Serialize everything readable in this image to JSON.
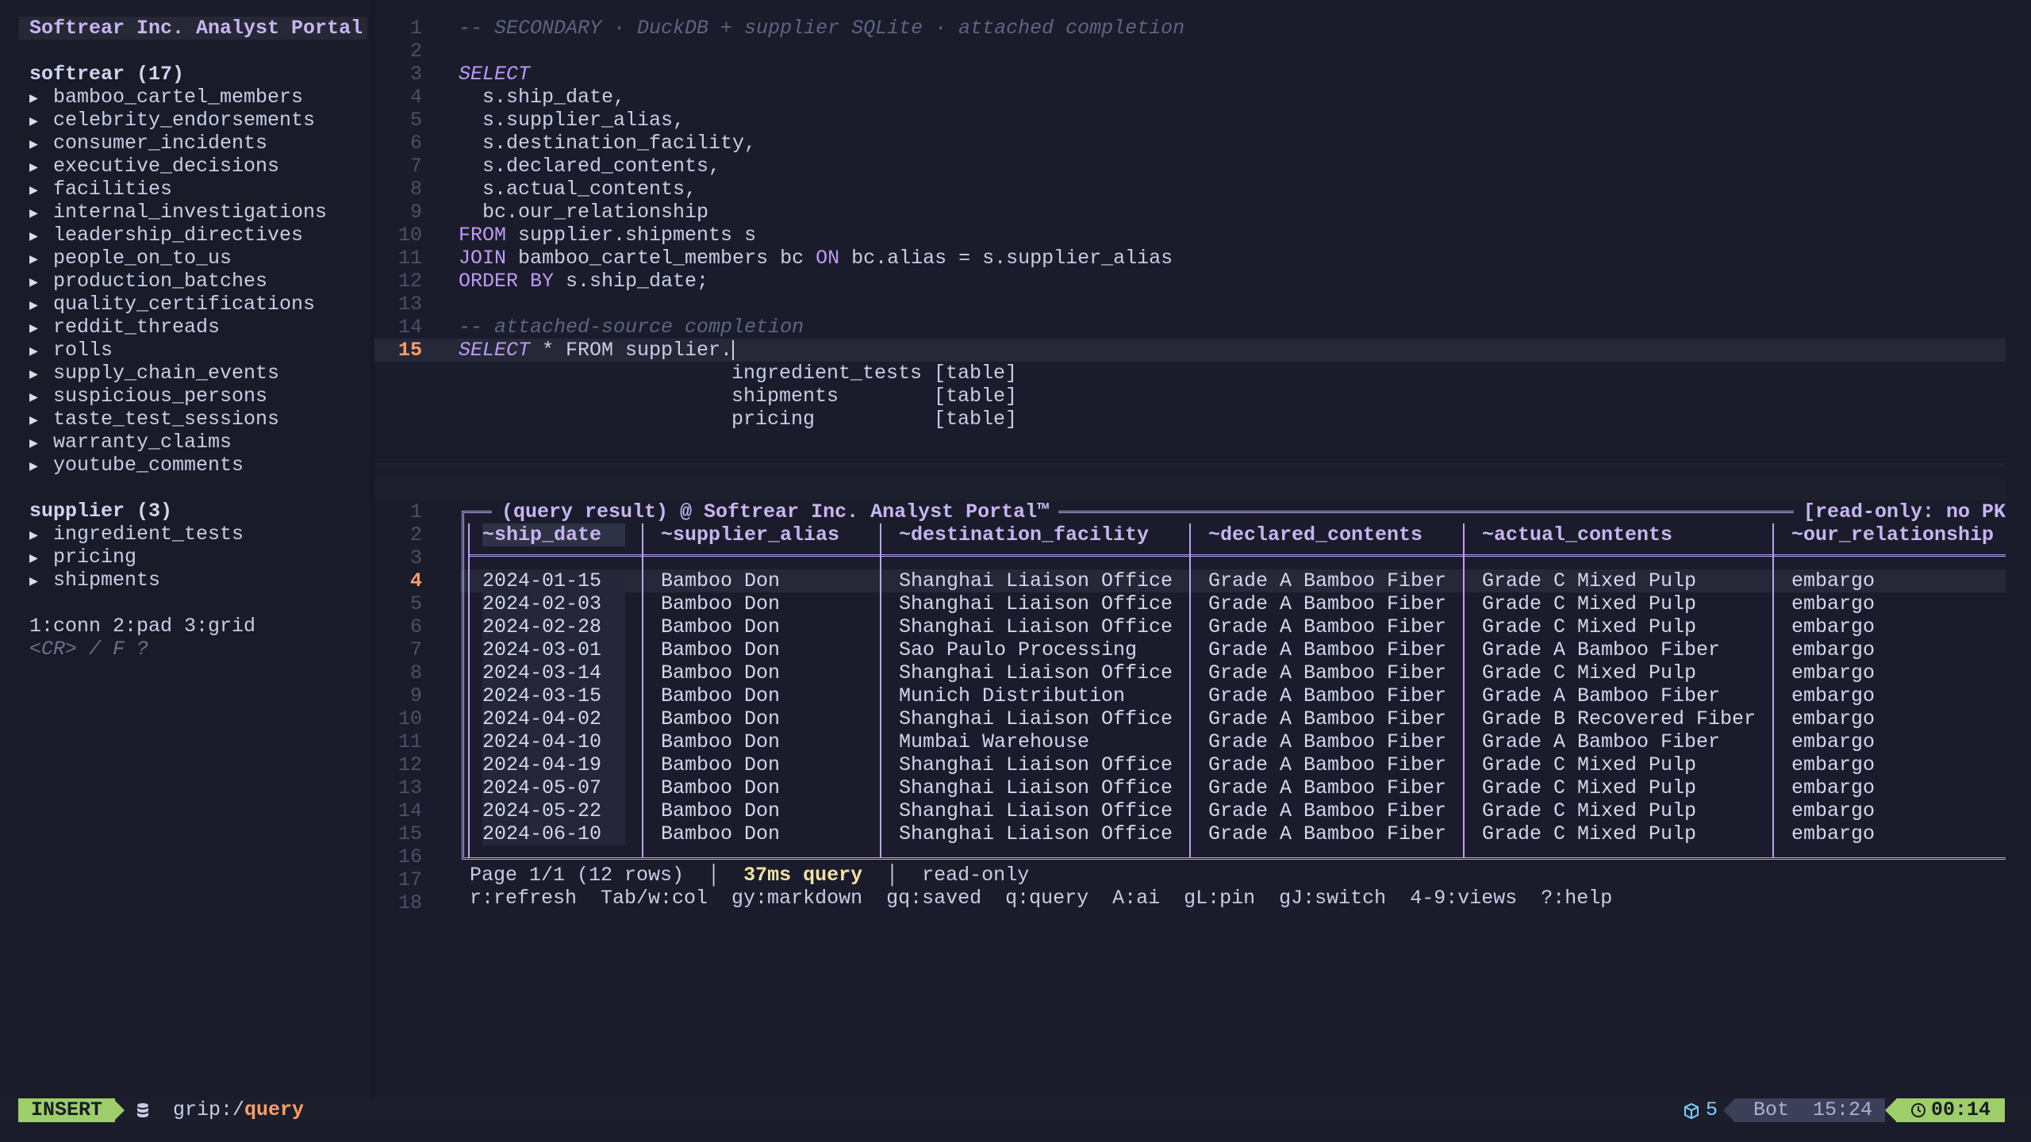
{
  "sidebar": {
    "title": "Softrear Inc. Analyst Portal",
    "groups": [
      {
        "header": "softrear (17)",
        "items": [
          "bamboo_cartel_members",
          "celebrity_endorsements",
          "consumer_incidents",
          "executive_decisions",
          "facilities",
          "internal_investigations",
          "leadership_directives",
          "people_on_to_us",
          "production_batches",
          "quality_certifications",
          "reddit_threads",
          "rolls",
          "supply_chain_events",
          "suspicious_persons",
          "taste_test_sessions",
          "warranty_claims",
          "youtube_comments"
        ]
      },
      {
        "header": "supplier (3)",
        "items": [
          "ingredient_tests",
          "pricing",
          "shipments"
        ]
      }
    ],
    "hint_keys": "1:conn 2:pad 3:grid",
    "hint_help": "<CR> / F ?"
  },
  "editor": {
    "line_numbers": [
      "1",
      "2",
      "3",
      "4",
      "5",
      "6",
      "7",
      "8",
      "9",
      "10",
      "11",
      "12",
      "13",
      "14",
      "15"
    ],
    "lines": {
      "l1": "-- SECONDARY · DuckDB + supplier SQLite · attached completion",
      "l3_kw": "SELECT",
      "l4": "  s.ship_date,",
      "l5": "  s.supplier_alias,",
      "l6": "  s.destination_facility,",
      "l7": "  s.declared_contents,",
      "l8": "  s.actual_contents,",
      "l9": "  bc.our_relationship",
      "l10_kw": "FROM",
      "l10_rest": " supplier.shipments s",
      "l11_kw": "JOIN",
      "l11_mid": " bamboo_cartel_members bc ",
      "l11_kw2": "ON",
      "l11_rest": " bc.alias = s.supplier_alias",
      "l12_kw": "ORDER BY",
      "l12_rest": " s.ship_date;",
      "l14": "-- attached-source completion",
      "l15_kw": "SELECT",
      "l15_rest": " * FROM supplier."
    },
    "completion": [
      {
        "name": "ingredient_tests",
        "kind": "[table]"
      },
      {
        "name": "shipments",
        "kind": "[table]"
      },
      {
        "name": "pricing",
        "kind": "[table]"
      }
    ]
  },
  "result": {
    "line_numbers": [
      "1",
      "2",
      "3",
      "4",
      "5",
      "6",
      "7",
      "8",
      "9",
      "10",
      "11",
      "12",
      "13",
      "14",
      "15",
      "16",
      "17",
      "18"
    ],
    "title": "(query result) @ Softrear Inc. Analyst Portal™",
    "readonly_tag": "[read-only: no PK",
    "columns": [
      "~ship_date",
      "~supplier_alias",
      "~destination_facility",
      "~declared_contents",
      "~actual_contents",
      "~our_relationship"
    ],
    "rows": [
      [
        "2024-01-15",
        "Bamboo Don",
        "Shanghai Liaison Office",
        "Grade A Bamboo Fiber",
        "Grade C Mixed Pulp",
        "embargo"
      ],
      [
        "2024-02-03",
        "Bamboo Don",
        "Shanghai Liaison Office",
        "Grade A Bamboo Fiber",
        "Grade C Mixed Pulp",
        "embargo"
      ],
      [
        "2024-02-28",
        "Bamboo Don",
        "Shanghai Liaison Office",
        "Grade A Bamboo Fiber",
        "Grade C Mixed Pulp",
        "embargo"
      ],
      [
        "2024-03-01",
        "Bamboo Don",
        "Sao Paulo Processing",
        "Grade A Bamboo Fiber",
        "Grade A Bamboo Fiber",
        "embargo"
      ],
      [
        "2024-03-14",
        "Bamboo Don",
        "Shanghai Liaison Office",
        "Grade A Bamboo Fiber",
        "Grade C Mixed Pulp",
        "embargo"
      ],
      [
        "2024-03-15",
        "Bamboo Don",
        "Munich Distribution",
        "Grade A Bamboo Fiber",
        "Grade A Bamboo Fiber",
        "embargo"
      ],
      [
        "2024-04-02",
        "Bamboo Don",
        "Shanghai Liaison Office",
        "Grade A Bamboo Fiber",
        "Grade B Recovered Fiber",
        "embargo"
      ],
      [
        "2024-04-10",
        "Bamboo Don",
        "Mumbai Warehouse",
        "Grade A Bamboo Fiber",
        "Grade A Bamboo Fiber",
        "embargo"
      ],
      [
        "2024-04-19",
        "Bamboo Don",
        "Shanghai Liaison Office",
        "Grade A Bamboo Fiber",
        "Grade C Mixed Pulp",
        "embargo"
      ],
      [
        "2024-05-07",
        "Bamboo Don",
        "Shanghai Liaison Office",
        "Grade A Bamboo Fiber",
        "Grade C Mixed Pulp",
        "embargo"
      ],
      [
        "2024-05-22",
        "Bamboo Don",
        "Shanghai Liaison Office",
        "Grade A Bamboo Fiber",
        "Grade C Mixed Pulp",
        "embargo"
      ],
      [
        "2024-06-10",
        "Bamboo Don",
        "Shanghai Liaison Office",
        "Grade A Bamboo Fiber",
        "Grade C Mixed Pulp",
        "embargo"
      ]
    ],
    "page_info": "Page 1/1 (12 rows)",
    "sep": "│",
    "timing": "37ms query",
    "mode": "read-only",
    "keys": "r:refresh  Tab/w:col  gy:markdown  gq:saved  q:query  A:ai  gL:pin  gJ:switch  4-9:views  ?:help"
  },
  "statusbar": {
    "mode": "INSERT",
    "db_icon": "database-icon",
    "grip_prefix": "grip:/",
    "grip_query": "query",
    "cube_icon": "cube-icon",
    "cube_count": "5",
    "position": "Bot  15:24",
    "clock_icon": "clock-icon",
    "time": "00:14"
  },
  "colors": {
    "background": "#1b1c2b",
    "keyword": "#bb9af7",
    "comment": "#5e6381",
    "accent_orange": "#ff9e64",
    "accent_green": "#9ece6a",
    "frame": "#b9a3ee"
  }
}
